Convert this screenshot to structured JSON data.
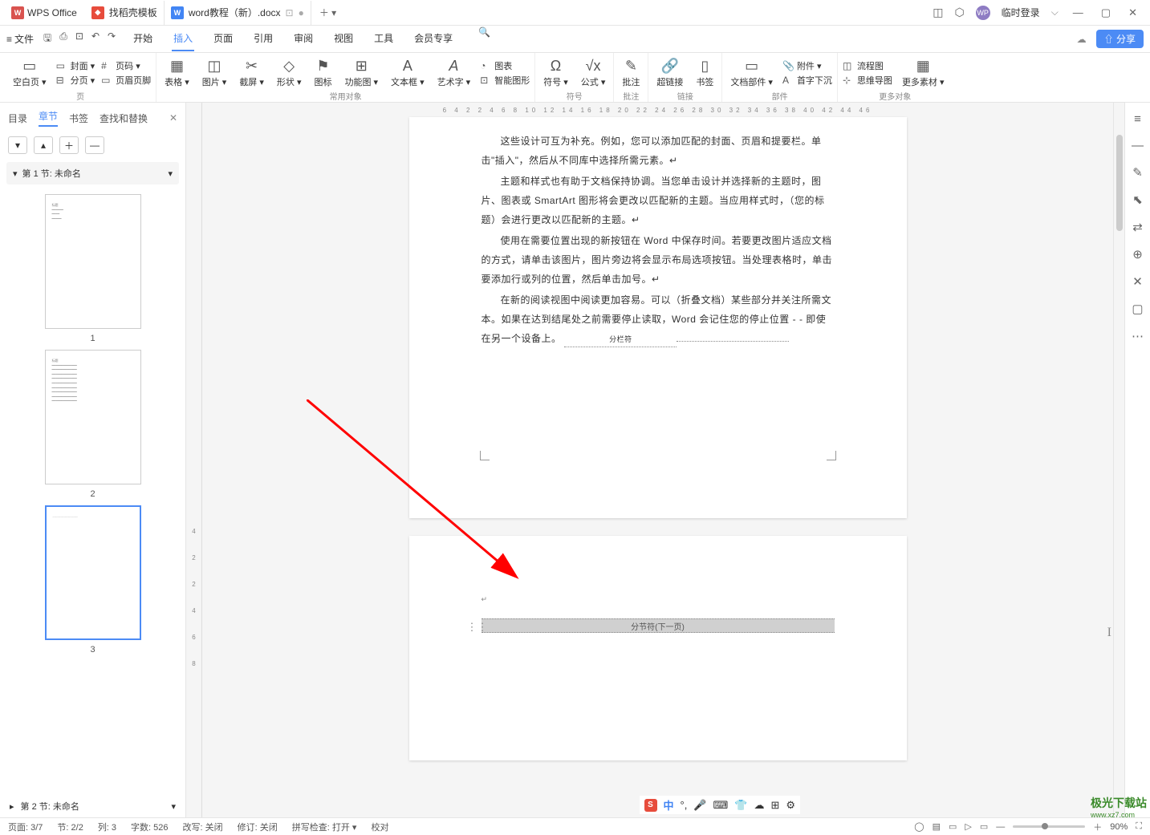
{
  "app": {
    "name": "WPS Office"
  },
  "tabs": [
    {
      "label": "找稻壳模板",
      "color": "red"
    },
    {
      "label": "word教程（新）.docx",
      "color": "blue",
      "active": true,
      "dot": "○",
      "close": "●"
    }
  ],
  "title_right": {
    "login": "临时登录",
    "avatar": "WP"
  },
  "menu": {
    "file": "文件",
    "items": [
      "开始",
      "插入",
      "页面",
      "引用",
      "审阅",
      "视图",
      "工具",
      "会员专享"
    ],
    "active": "插入",
    "share": "分享"
  },
  "ribbon": {
    "groups": [
      {
        "title": "页",
        "big": [
          {
            "ico": "▭",
            "lbl": "空白页 ▾"
          }
        ],
        "stack": [
          {
            "ico": "▭",
            "lbl": "封面 ▾"
          },
          {
            "ico": "⊟",
            "lbl": "分页 ▾"
          }
        ],
        "stack2": [
          {
            "ico": "#",
            "lbl": "页码 ▾"
          },
          {
            "ico": "▭",
            "lbl": "页眉页脚"
          }
        ]
      },
      {
        "title": "常用对象",
        "big": [
          {
            "ico": "▦",
            "lbl": "表格 ▾"
          },
          {
            "ico": "◫",
            "lbl": "图片 ▾"
          },
          {
            "ico": "✂",
            "lbl": "截屏 ▾"
          },
          {
            "ico": "◇",
            "lbl": "形状 ▾"
          },
          {
            "ico": "⚑",
            "lbl": "图标"
          },
          {
            "ico": "⊞",
            "lbl": "功能图 ▾"
          },
          {
            "ico": "A",
            "lbl": "文本框 ▾"
          },
          {
            "ico": "A",
            "lbl": "艺术字 ▾"
          }
        ],
        "stack": [
          {
            "ico": "◔",
            "lbl": "图表"
          },
          {
            "ico": "⊡",
            "lbl": "智能图形"
          }
        ]
      },
      {
        "title": "符号",
        "big": [
          {
            "ico": "Ω",
            "lbl": "符号 ▾"
          },
          {
            "ico": "√x",
            "lbl": "公式 ▾"
          }
        ]
      },
      {
        "title": "批注",
        "big": [
          {
            "ico": "✎",
            "lbl": "批注"
          }
        ]
      },
      {
        "title": "链接",
        "big": [
          {
            "ico": "🔗",
            "lbl": "超链接"
          },
          {
            "ico": "▯",
            "lbl": "书签"
          }
        ]
      },
      {
        "title": "部件",
        "big": [
          {
            "ico": "▭",
            "lbl": "文档部件 ▾"
          }
        ],
        "stack": [
          {
            "ico": "📎",
            "lbl": "附件 ▾"
          },
          {
            "ico": "A",
            "lbl": "首字下沉"
          }
        ]
      },
      {
        "title": "更多对象",
        "stack": [
          {
            "ico": "◫",
            "lbl": "流程图"
          },
          {
            "ico": "⊹",
            "lbl": "思维导图"
          }
        ],
        "big": [
          {
            "ico": "▦",
            "lbl": "更多素材 ▾"
          }
        ]
      }
    ]
  },
  "nav": {
    "tabs": [
      "目录",
      "章节",
      "书签",
      "查找和替换"
    ],
    "active": "章节",
    "sections": [
      {
        "label": "第 1 节: 未命名"
      },
      {
        "label": "第 2 节: 未命名"
      }
    ],
    "thumbs": [
      "1",
      "2",
      "3"
    ]
  },
  "document": {
    "p1": "这些设计可互为补充。例如，您可以添加匹配的封面、页眉和提要栏。单击\"插入\"，然后从不同库中选择所需元素。↵",
    "p2": "主题和样式也有助于文档保持协调。当您单击设计并选择新的主题时，图片、图表或 SmartArt 图形将会更改以匹配新的主题。当应用样式时，（您的标题）会进行更改以匹配新的主题。↵",
    "p3": "使用在需要位置出现的新按钮在 Word 中保存时间。若要更改图片适应文档的方式，请单击该图片，图片旁边将会显示布局选项按钮。当处理表格时，单击要添加行或列的位置，然后单击加号。↵",
    "p4": "在新的阅读视图中阅读更加容易。可以（折叠文档）某些部分并关注所需文本。如果在达到结尾处之前需要停止读取，Word 会记住您的停止位置 - - 即使在另一个设备上。",
    "break_label": "分栏符",
    "section_break": "分节符(下一页)"
  },
  "ruler": {
    "h": "6  4  2     2  4  6  8  10 12 14 16 18 20 22 24 26 28 30 32 34 36 38 40 42 44 46",
    "v": [
      "4",
      "2",
      "",
      "2",
      "4",
      "6",
      "8"
    ]
  },
  "status": {
    "page": "页面: 3/7",
    "section": "节: 2/2",
    "col": "列: 3",
    "chars": "字数: 526",
    "rewrite": "改写: 关闭",
    "revision": "修订: 关闭",
    "spell": "拼写检查: 打开 ▾",
    "proof": "校对",
    "zoom": "90%"
  },
  "ime": {
    "lang": "中",
    "items": [
      "🎤",
      "⌨",
      "👕",
      "☁",
      "⊞",
      "⚙"
    ]
  },
  "watermark": {
    "l1": "极光下载站",
    "l2": "www.xz7.com"
  }
}
